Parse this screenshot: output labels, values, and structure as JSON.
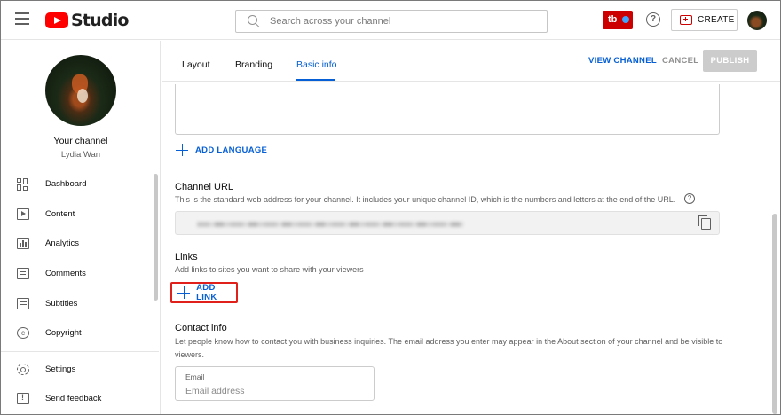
{
  "header": {
    "logo_text": "Studio",
    "search_placeholder": "Search across your channel",
    "extension_label": "tb",
    "help_label": "?",
    "create_label": "CREATE"
  },
  "sidebar": {
    "your_channel": "Your channel",
    "channel_name": "Lydia Wan",
    "items": [
      {
        "label": "Dashboard",
        "icon": "dashboard-icon"
      },
      {
        "label": "Content",
        "icon": "content-icon"
      },
      {
        "label": "Analytics",
        "icon": "analytics-icon"
      },
      {
        "label": "Comments",
        "icon": "comments-icon"
      },
      {
        "label": "Subtitles",
        "icon": "subtitles-icon"
      },
      {
        "label": "Copyright",
        "icon": "copyright-icon"
      }
    ],
    "bottom_items": [
      {
        "label": "Settings",
        "icon": "gear-icon"
      },
      {
        "label": "Send feedback",
        "icon": "feedback-icon"
      }
    ]
  },
  "tabs": [
    {
      "label": "Layout",
      "active": false
    },
    {
      "label": "Branding",
      "active": false
    },
    {
      "label": "Basic info",
      "active": true
    }
  ],
  "actions": {
    "view_channel": "VIEW CHANNEL",
    "cancel": "CANCEL",
    "publish": "PUBLISH"
  },
  "add_language": "ADD LANGUAGE",
  "channel_url": {
    "title": "Channel URL",
    "description": "This is the standard web address for your channel. It includes your unique channel ID, which is the numbers and letters at the end of the URL.",
    "help": "?"
  },
  "links": {
    "title": "Links",
    "description": "Add links to sites you want to share with your viewers",
    "add_link": "ADD LINK"
  },
  "contact": {
    "title": "Contact info",
    "description": "Let people know how to contact you with business inquiries. The email address you enter may appear in the About section of your channel and be visible to viewers.",
    "email_label": "Email",
    "email_placeholder": "Email address"
  },
  "colors": {
    "accent_blue": "#065fd4",
    "highlight_red": "#e0201b",
    "brand_red": "#ff0000"
  }
}
